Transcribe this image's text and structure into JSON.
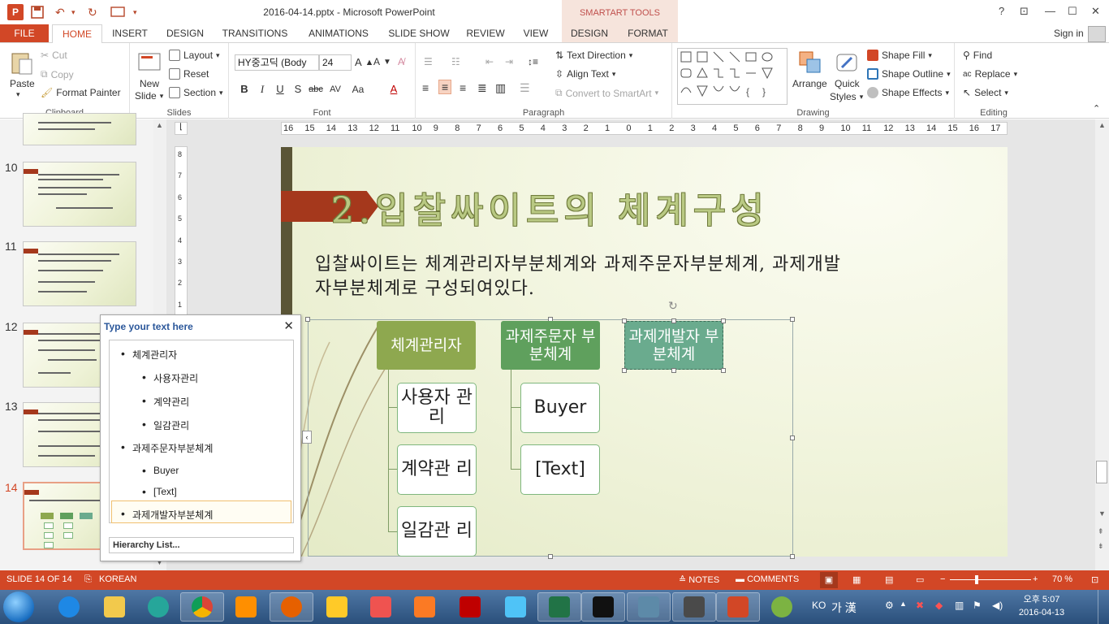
{
  "window": {
    "title": "2016-04-14.pptx - Microsoft PowerPoint",
    "contextual_header": "SMARTART TOOLS",
    "sign_in": "Sign in",
    "help": "?"
  },
  "tabs": [
    {
      "label": "FILE"
    },
    {
      "label": "HOME"
    },
    {
      "label": "INSERT"
    },
    {
      "label": "DESIGN"
    },
    {
      "label": "TRANSITIONS"
    },
    {
      "label": "ANIMATIONS"
    },
    {
      "label": "SLIDE SHOW"
    },
    {
      "label": "REVIEW"
    },
    {
      "label": "VIEW"
    },
    {
      "label": "DESIGN"
    },
    {
      "label": "FORMAT"
    }
  ],
  "ribbon": {
    "clipboard": {
      "label": "Clipboard",
      "paste": "Paste",
      "cut": "Cut",
      "copy": "Copy",
      "format_painter": "Format Painter"
    },
    "slides": {
      "label": "Slides",
      "new_slide_1": "New",
      "new_slide_2": "Slide",
      "layout": "Layout",
      "reset": "Reset",
      "section": "Section"
    },
    "font": {
      "label": "Font",
      "font_name": "HY중고딕 (Body",
      "font_size": "24"
    },
    "paragraph": {
      "label": "Paragraph",
      "text_direction": "Text Direction",
      "align_text": "Align Text",
      "convert": "Convert to SmartArt"
    },
    "drawing": {
      "label": "Drawing",
      "arrange": "Arrange",
      "quick_styles_1": "Quick",
      "quick_styles_2": "Styles",
      "shape_fill": "Shape Fill",
      "shape_outline": "Shape Outline",
      "shape_effects": "Shape Effects"
    },
    "editing": {
      "label": "Editing",
      "find": "Find",
      "replace": "Replace",
      "select": "Select"
    }
  },
  "thumbnails": [
    {
      "number": "10"
    },
    {
      "number": "11"
    },
    {
      "number": "12"
    },
    {
      "number": "13"
    },
    {
      "number": "14",
      "selected": true
    }
  ],
  "ruler": {
    "h_ticks": [
      "16",
      "15",
      "14",
      "13",
      "12",
      "11",
      "10",
      "9",
      "8",
      "7",
      "6",
      "5",
      "4",
      "3",
      "2",
      "1",
      "0",
      "1",
      "2",
      "3",
      "4",
      "5",
      "6",
      "7",
      "8",
      "9",
      "10",
      "11",
      "12",
      "13",
      "14",
      "15",
      "16",
      "17"
    ],
    "v_ticks": [
      "8",
      "7",
      "6",
      "5",
      "4",
      "3",
      "2",
      "1"
    ]
  },
  "slide": {
    "title": "2.입찰싸이트의  체계구성",
    "body_line1": "입찰싸이트는  체계관리자부분체계와  과제주문자부분체계, 과제개발",
    "body_line2": "자부분체계로  구성되여있다.",
    "smartart": {
      "top": [
        "체계관리자",
        "과제주문자 부분체계",
        "과제개발자 부분체계"
      ],
      "col1": [
        "사용자 관리",
        "계약관 리",
        "일감관 리"
      ],
      "col2": [
        "Buyer",
        "[Text]"
      ],
      "colors": {
        "top1": "#8ea84f",
        "top2": "#5fa05d",
        "top3": "#6aab8e"
      }
    }
  },
  "text_pane": {
    "title": "Type your text here",
    "items": [
      {
        "level": 1,
        "text": "체계관리자"
      },
      {
        "level": 2,
        "text": "사용자관리"
      },
      {
        "level": 2,
        "text": "계약관리"
      },
      {
        "level": 2,
        "text": "일감관리"
      },
      {
        "level": 1,
        "text": "과제주문자부분체계"
      },
      {
        "level": 2,
        "text": "Buyer"
      },
      {
        "level": 2,
        "text": "[Text]"
      },
      {
        "level": 1,
        "text": "과제개발자부분체계"
      }
    ],
    "footer": "Hierarchy List..."
  },
  "status": {
    "slide": "SLIDE 14 OF 14",
    "language": "KOREAN",
    "notes": "NOTES",
    "comments": "COMMENTS",
    "zoom": "70 %"
  },
  "taskbar": {
    "ime": "KO",
    "ime_mode": "가 漢",
    "time": "오후 5:07",
    "date": "2016-04-13"
  },
  "colors": {
    "accent": "#d24726",
    "taskbar": "#2a4f7b"
  }
}
